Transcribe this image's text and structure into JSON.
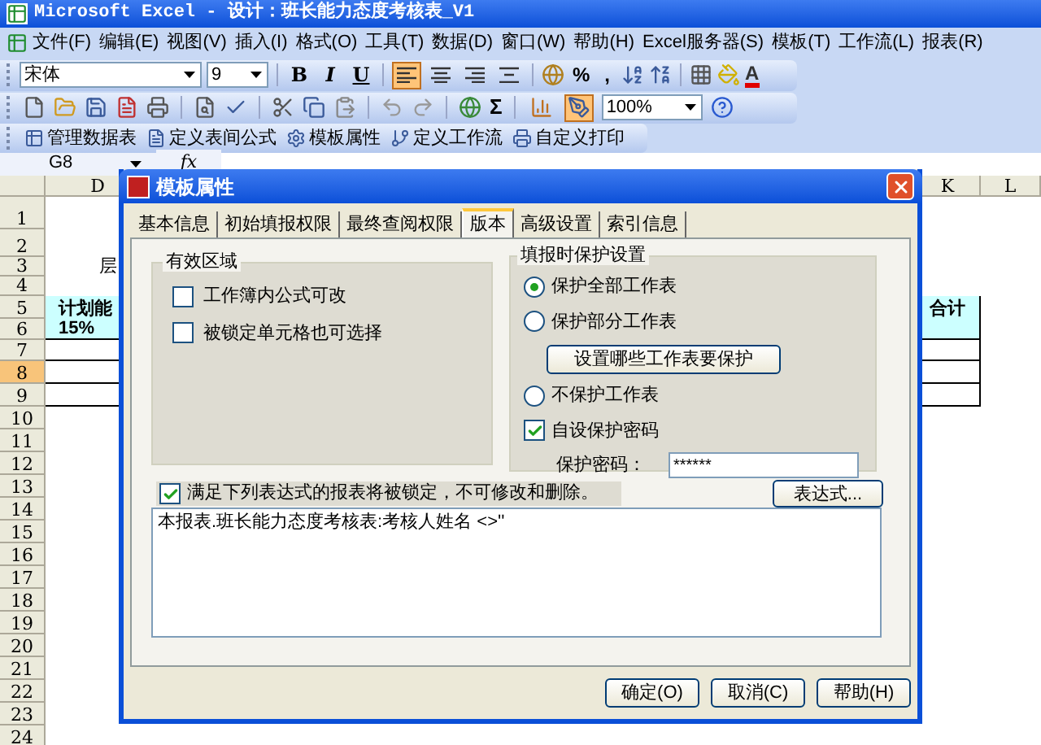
{
  "window": {
    "title": "Microsoft Excel - 设计：班长能力态度考核表_V1"
  },
  "menu": [
    "文件(F)",
    "编辑(E)",
    "视图(V)",
    "插入(I)",
    "格式(O)",
    "工具(T)",
    "数据(D)",
    "窗口(W)",
    "帮助(H)",
    "Excel服务器(S)",
    "模板(T)",
    "工作流(L)",
    "报表(R)"
  ],
  "formatting_toolbar": {
    "font": "宋体",
    "size": "9",
    "styles": [
      "B",
      "I",
      "U"
    ],
    "alignment": [
      {
        "selected": true
      },
      {
        "selected": false
      },
      {
        "selected": false
      },
      {
        "selected": false
      }
    ],
    "percent": "%",
    "comma": ",",
    "font_color": "A"
  },
  "standard_toolbar": {
    "sum": "Σ",
    "zoom": "100%",
    "toggles": [
      {
        "selected": false
      },
      {
        "selected": true
      }
    ]
  },
  "custom_toolbar": [
    "管理数据表",
    "定义表间公式",
    "模板属性",
    "定义工作流",
    "自定义打印"
  ],
  "formula_bar": {
    "name_box": "G8",
    "function_label": "fx"
  },
  "sheet": {
    "columns": [
      "D",
      "K",
      "L"
    ],
    "rows": [
      {
        "label": "1",
        "selected": false
      },
      {
        "label": "2",
        "selected": false
      },
      {
        "label": "3",
        "selected": false
      },
      {
        "label": "4",
        "selected": false
      },
      {
        "label": "5",
        "selected": false
      },
      {
        "label": "6",
        "selected": false
      },
      {
        "label": "7",
        "selected": false
      },
      {
        "label": "8",
        "selected": true
      },
      {
        "label": "9",
        "selected": false
      },
      {
        "label": "10",
        "selected": false
      },
      {
        "label": "11",
        "selected": false
      },
      {
        "label": "12",
        "selected": false
      },
      {
        "label": "13",
        "selected": false
      },
      {
        "label": "14",
        "selected": false
      },
      {
        "label": "15",
        "selected": false
      },
      {
        "label": "16",
        "selected": false
      },
      {
        "label": "17",
        "selected": false
      },
      {
        "label": "18",
        "selected": false
      },
      {
        "label": "19",
        "selected": false
      },
      {
        "label": "20",
        "selected": false
      },
      {
        "label": "21",
        "selected": false
      },
      {
        "label": "22",
        "selected": false
      },
      {
        "label": "23",
        "selected": false
      },
      {
        "label": "24",
        "selected": false
      }
    ],
    "cells": {
      "d3": "层",
      "d5": "计划能",
      "d6": "15%",
      "k5": "合计"
    }
  },
  "dialog": {
    "title": "模板属性",
    "tabs": [
      {
        "label": "基本信息",
        "selected": false
      },
      {
        "label": "初始填报权限",
        "selected": false
      },
      {
        "label": "最终查阅权限",
        "selected": false
      },
      {
        "label": "版本",
        "selected": true
      },
      {
        "label": "高级设置",
        "selected": false
      },
      {
        "label": "索引信息",
        "selected": false
      }
    ],
    "valid_area": {
      "title": "有效区域",
      "options": [
        {
          "label": "工作簿内公式可改",
          "checked": false
        },
        {
          "label": "被锁定单元格也可选择",
          "checked": false
        }
      ]
    },
    "protection": {
      "title": "填报时保护设置",
      "options": [
        {
          "kind": "radio",
          "label": "保护全部工作表",
          "selected": true
        },
        {
          "kind": "radio",
          "label": "保护部分工作表",
          "selected": false
        },
        {
          "kind": "button",
          "label": "设置哪些工作表要保护"
        },
        {
          "kind": "radio",
          "label": "不保护工作表",
          "selected": false
        },
        {
          "kind": "checkbox",
          "label": "自设保护密码",
          "checked": true
        },
        {
          "kind": "password",
          "label": "保护密码：",
          "value": "******"
        }
      ]
    },
    "lock": {
      "label": "满足下列表达式的报表将被锁定，不可修改和删除。",
      "checked": true,
      "button": "表达式...",
      "expression": "本报表.班长能力态度考核表:考核人姓名 <>''"
    },
    "buttons": [
      "确定(O)",
      "取消(C)",
      "帮助(H)"
    ]
  }
}
